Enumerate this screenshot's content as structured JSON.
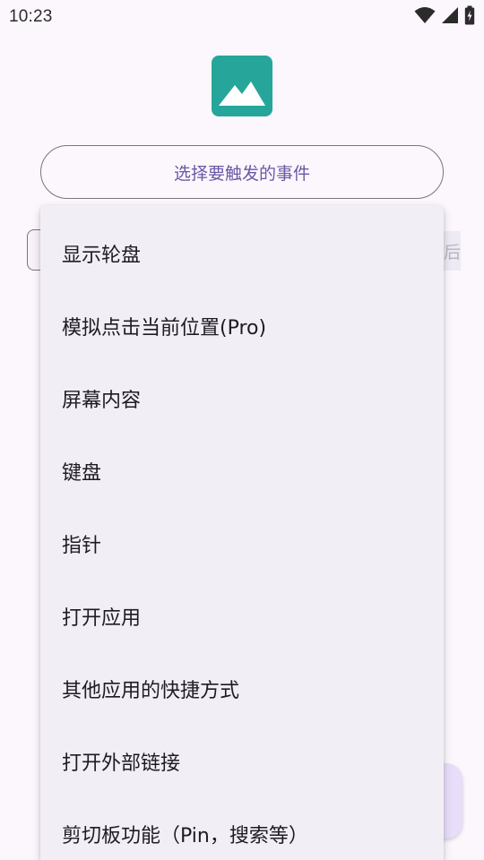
{
  "status_bar": {
    "time": "10:23",
    "icons": [
      "wifi-icon",
      "cellular-signal-icon",
      "battery-charging-icon"
    ]
  },
  "app": {
    "icon": "image-icon",
    "icon_color": "#26a69a"
  },
  "event_selector": {
    "label": "选择要触发的事件"
  },
  "background": {
    "chip_text": "后"
  },
  "menu": {
    "items": [
      {
        "label": "显示轮盘"
      },
      {
        "label": "模拟点击当前位置(Pro)"
      },
      {
        "label": "屏幕内容"
      },
      {
        "label": "键盘"
      },
      {
        "label": "指针"
      },
      {
        "label": "打开应用"
      },
      {
        "label": "其他应用的快捷方式"
      },
      {
        "label": "打开外部链接"
      },
      {
        "label": "剪切板功能（Pin，搜索等）"
      }
    ]
  },
  "colors": {
    "accent": "#6b57a6",
    "menu_bg": "#f2eef5",
    "page_bg": "#fcf7fd",
    "fab_bg": "#e8defa"
  }
}
